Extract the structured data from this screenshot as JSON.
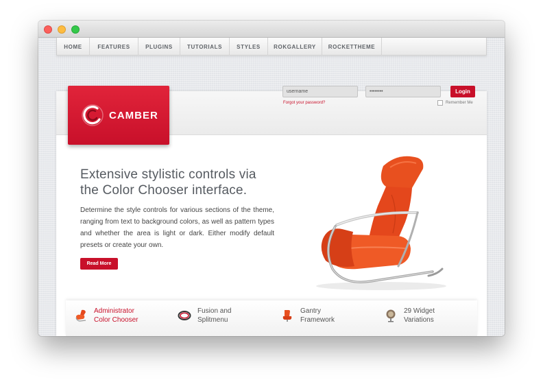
{
  "window": {
    "controls": [
      "close",
      "minimize",
      "maximize"
    ]
  },
  "nav": {
    "items": [
      {
        "label": "HOME"
      },
      {
        "label": "FEATURES"
      },
      {
        "label": "PLUGINS"
      },
      {
        "label": "TUTORIALS"
      },
      {
        "label": "STYLES"
      },
      {
        "label": "ROKGALLERY"
      },
      {
        "label": "ROCKETTHEME"
      }
    ]
  },
  "brand": {
    "name": "CAMBER",
    "accent_color": "#c8102a"
  },
  "login": {
    "username_value": "username",
    "password_value": "••••••••",
    "button_label": "Login",
    "forgot_link": "Forgot your password?",
    "remember_label": "Remember Me",
    "remember_checked": false
  },
  "hero": {
    "headline_line1": "Extensive stylistic controls via",
    "headline_line2": "the Color Chooser interface.",
    "body": "Determine the style controls for various sections of the theme, ranging from text to background colors, as well as pattern types and whether the area is light or dark. Either modify default presets or create your own.",
    "button_label": "Read More",
    "image": "orange-lounge-chair"
  },
  "features": [
    {
      "line1": "Administrator",
      "line2": "Color Chooser",
      "icon": "chair-icon",
      "active": true
    },
    {
      "line1": "Fusion and",
      "line2": "Splitmenu",
      "icon": "ring-icon",
      "active": false
    },
    {
      "line1": "Gantry",
      "line2": "Framework",
      "icon": "seat-icon",
      "active": false
    },
    {
      "line1": "29 Widget",
      "line2": "Variations",
      "icon": "stool-icon",
      "active": false
    }
  ]
}
